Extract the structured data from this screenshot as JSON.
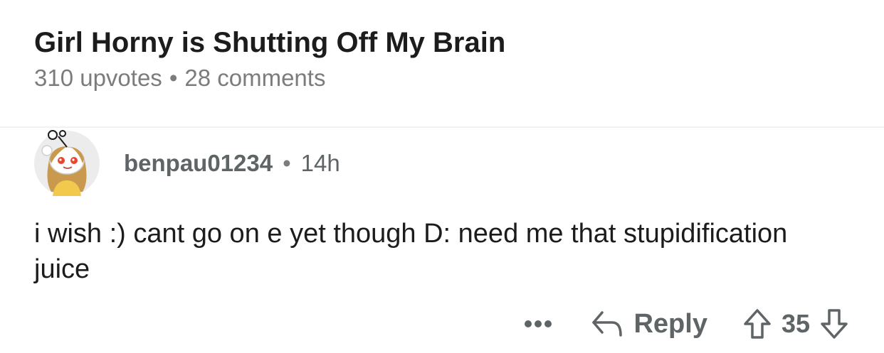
{
  "post": {
    "title": "Girl Horny is Shutting Off My Brain",
    "upvotes": "310 upvotes",
    "separator": "•",
    "comments": "28 comments"
  },
  "comment": {
    "author": "benpau01234",
    "separator": "•",
    "age": "14h",
    "body": "i wish :) cant go on e yet though D: need me that stupidification juice",
    "avatar_icon": "snoo-avatar",
    "actions": {
      "more_icon": "more-dots-icon",
      "reply_icon": "reply-arrow-icon",
      "reply_label": "Reply",
      "upvote_icon": "upvote-arrow-icon",
      "score": "35",
      "downvote_icon": "downvote-arrow-icon"
    }
  },
  "colors": {
    "title": "#1c1c1c",
    "meta": "#7c7c7c",
    "action": "#5f6466",
    "avatar_bg": "#ececec",
    "avatar_hair": "#c99a4e",
    "avatar_shirt": "#f2c94c",
    "avatar_eyes": "#e8442e"
  }
}
